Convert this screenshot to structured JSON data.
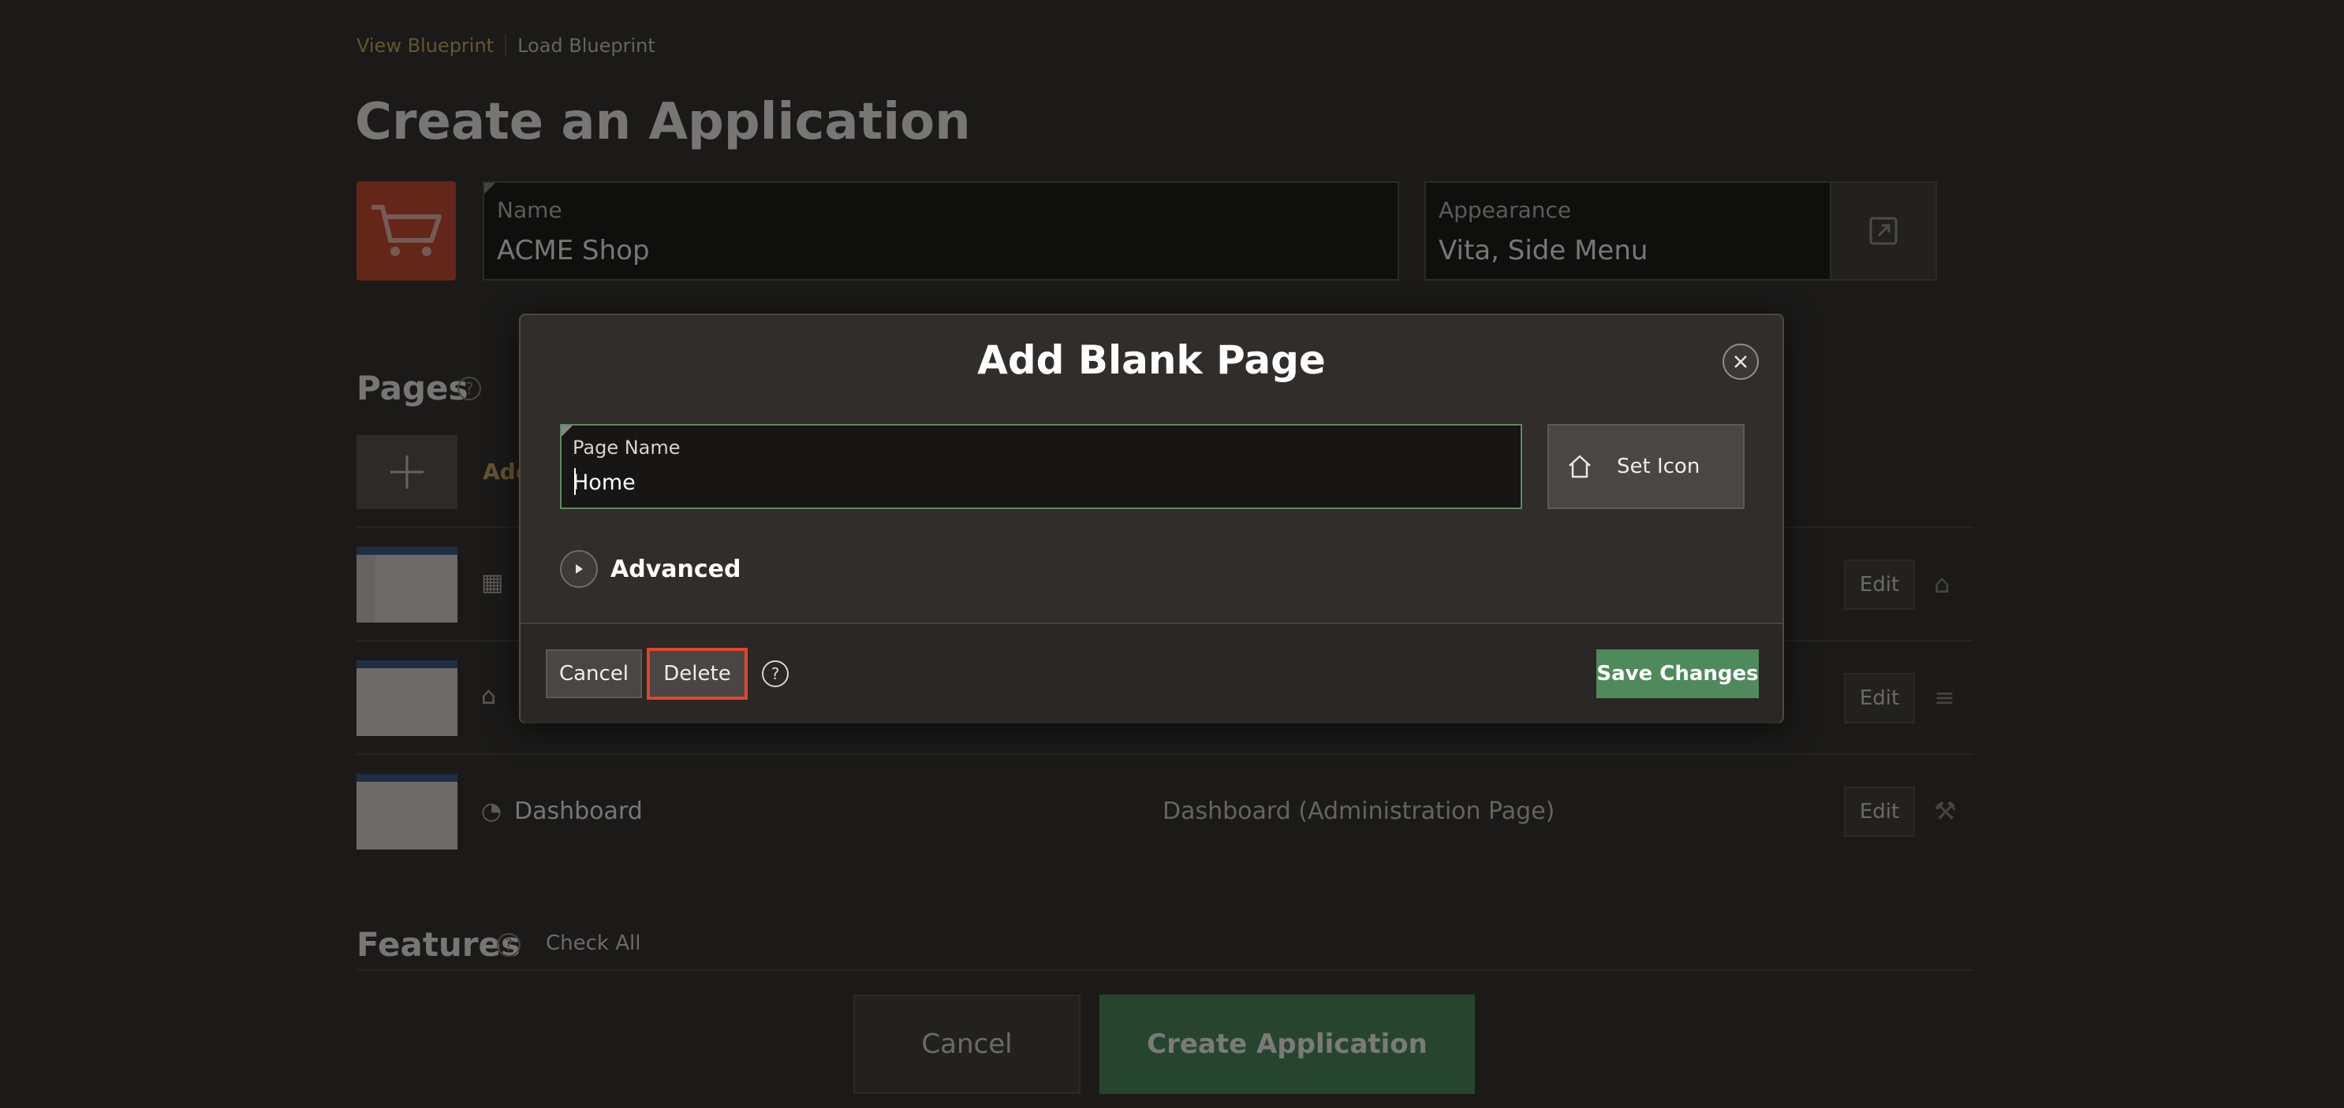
{
  "breadcrumb": {
    "view": "View Blueprint",
    "load": "Load Blueprint"
  },
  "page_title": "Create an Application",
  "app": {
    "icon": "shopping-cart-icon",
    "name_label": "Name",
    "name_value": "ACME Shop",
    "appearance_label": "Appearance",
    "appearance_value": "Vita, Side Menu"
  },
  "pages": {
    "title": "Pages",
    "add_label": "Add",
    "rows": [
      {
        "name": "",
        "type": "",
        "edit": "Edit",
        "icon": "table-icon",
        "end_icon": "home-icon"
      },
      {
        "name": "",
        "type": "",
        "edit": "Edit",
        "icon": "home-icon",
        "end_icon": "menu-icon"
      },
      {
        "name": "Dashboard",
        "type": "Dashboard (Administration Page)",
        "edit": "Edit",
        "icon": "gauge-icon",
        "end_icon": "wrench-icon"
      }
    ]
  },
  "features": {
    "title": "Features",
    "check_all": "Check All"
  },
  "footer": {
    "cancel": "Cancel",
    "create": "Create Application"
  },
  "dialog": {
    "title": "Add Blank Page",
    "page_name_label": "Page Name",
    "page_name_value": "Home",
    "set_icon_label": "Set Icon",
    "advanced_label": "Advanced",
    "cancel": "Cancel",
    "delete": "Delete",
    "save": "Save Changes"
  },
  "colors": {
    "accent_link": "#c8ab5c",
    "primary_green": "#4f8a5c",
    "highlight_red": "#e0452c",
    "app_icon_bg": "#c94d32"
  }
}
